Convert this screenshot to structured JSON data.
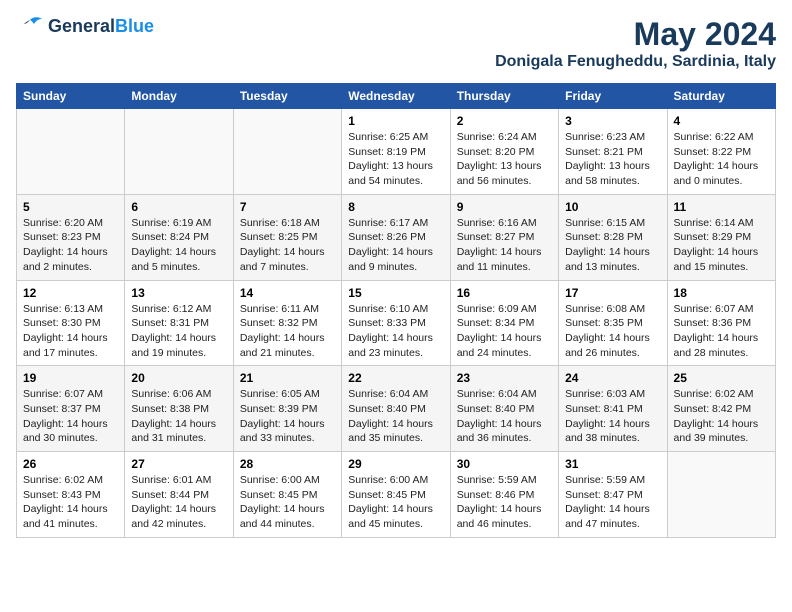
{
  "logo": {
    "line1": "General",
    "line2": "Blue"
  },
  "title": "May 2024",
  "location": "Donigala Fenugheddu, Sardinia, Italy",
  "weekdays": [
    "Sunday",
    "Monday",
    "Tuesday",
    "Wednesday",
    "Thursday",
    "Friday",
    "Saturday"
  ],
  "weeks": [
    [
      {
        "day": "",
        "text": ""
      },
      {
        "day": "",
        "text": ""
      },
      {
        "day": "",
        "text": ""
      },
      {
        "day": "1",
        "text": "Sunrise: 6:25 AM\nSunset: 8:19 PM\nDaylight: 13 hours\nand 54 minutes."
      },
      {
        "day": "2",
        "text": "Sunrise: 6:24 AM\nSunset: 8:20 PM\nDaylight: 13 hours\nand 56 minutes."
      },
      {
        "day": "3",
        "text": "Sunrise: 6:23 AM\nSunset: 8:21 PM\nDaylight: 13 hours\nand 58 minutes."
      },
      {
        "day": "4",
        "text": "Sunrise: 6:22 AM\nSunset: 8:22 PM\nDaylight: 14 hours\nand 0 minutes."
      }
    ],
    [
      {
        "day": "5",
        "text": "Sunrise: 6:20 AM\nSunset: 8:23 PM\nDaylight: 14 hours\nand 2 minutes."
      },
      {
        "day": "6",
        "text": "Sunrise: 6:19 AM\nSunset: 8:24 PM\nDaylight: 14 hours\nand 5 minutes."
      },
      {
        "day": "7",
        "text": "Sunrise: 6:18 AM\nSunset: 8:25 PM\nDaylight: 14 hours\nand 7 minutes."
      },
      {
        "day": "8",
        "text": "Sunrise: 6:17 AM\nSunset: 8:26 PM\nDaylight: 14 hours\nand 9 minutes."
      },
      {
        "day": "9",
        "text": "Sunrise: 6:16 AM\nSunset: 8:27 PM\nDaylight: 14 hours\nand 11 minutes."
      },
      {
        "day": "10",
        "text": "Sunrise: 6:15 AM\nSunset: 8:28 PM\nDaylight: 14 hours\nand 13 minutes."
      },
      {
        "day": "11",
        "text": "Sunrise: 6:14 AM\nSunset: 8:29 PM\nDaylight: 14 hours\nand 15 minutes."
      }
    ],
    [
      {
        "day": "12",
        "text": "Sunrise: 6:13 AM\nSunset: 8:30 PM\nDaylight: 14 hours\nand 17 minutes."
      },
      {
        "day": "13",
        "text": "Sunrise: 6:12 AM\nSunset: 8:31 PM\nDaylight: 14 hours\nand 19 minutes."
      },
      {
        "day": "14",
        "text": "Sunrise: 6:11 AM\nSunset: 8:32 PM\nDaylight: 14 hours\nand 21 minutes."
      },
      {
        "day": "15",
        "text": "Sunrise: 6:10 AM\nSunset: 8:33 PM\nDaylight: 14 hours\nand 23 minutes."
      },
      {
        "day": "16",
        "text": "Sunrise: 6:09 AM\nSunset: 8:34 PM\nDaylight: 14 hours\nand 24 minutes."
      },
      {
        "day": "17",
        "text": "Sunrise: 6:08 AM\nSunset: 8:35 PM\nDaylight: 14 hours\nand 26 minutes."
      },
      {
        "day": "18",
        "text": "Sunrise: 6:07 AM\nSunset: 8:36 PM\nDaylight: 14 hours\nand 28 minutes."
      }
    ],
    [
      {
        "day": "19",
        "text": "Sunrise: 6:07 AM\nSunset: 8:37 PM\nDaylight: 14 hours\nand 30 minutes."
      },
      {
        "day": "20",
        "text": "Sunrise: 6:06 AM\nSunset: 8:38 PM\nDaylight: 14 hours\nand 31 minutes."
      },
      {
        "day": "21",
        "text": "Sunrise: 6:05 AM\nSunset: 8:39 PM\nDaylight: 14 hours\nand 33 minutes."
      },
      {
        "day": "22",
        "text": "Sunrise: 6:04 AM\nSunset: 8:40 PM\nDaylight: 14 hours\nand 35 minutes."
      },
      {
        "day": "23",
        "text": "Sunrise: 6:04 AM\nSunset: 8:40 PM\nDaylight: 14 hours\nand 36 minutes."
      },
      {
        "day": "24",
        "text": "Sunrise: 6:03 AM\nSunset: 8:41 PM\nDaylight: 14 hours\nand 38 minutes."
      },
      {
        "day": "25",
        "text": "Sunrise: 6:02 AM\nSunset: 8:42 PM\nDaylight: 14 hours\nand 39 minutes."
      }
    ],
    [
      {
        "day": "26",
        "text": "Sunrise: 6:02 AM\nSunset: 8:43 PM\nDaylight: 14 hours\nand 41 minutes."
      },
      {
        "day": "27",
        "text": "Sunrise: 6:01 AM\nSunset: 8:44 PM\nDaylight: 14 hours\nand 42 minutes."
      },
      {
        "day": "28",
        "text": "Sunrise: 6:00 AM\nSunset: 8:45 PM\nDaylight: 14 hours\nand 44 minutes."
      },
      {
        "day": "29",
        "text": "Sunrise: 6:00 AM\nSunset: 8:45 PM\nDaylight: 14 hours\nand 45 minutes."
      },
      {
        "day": "30",
        "text": "Sunrise: 5:59 AM\nSunset: 8:46 PM\nDaylight: 14 hours\nand 46 minutes."
      },
      {
        "day": "31",
        "text": "Sunrise: 5:59 AM\nSunset: 8:47 PM\nDaylight: 14 hours\nand 47 minutes."
      },
      {
        "day": "",
        "text": ""
      }
    ]
  ]
}
